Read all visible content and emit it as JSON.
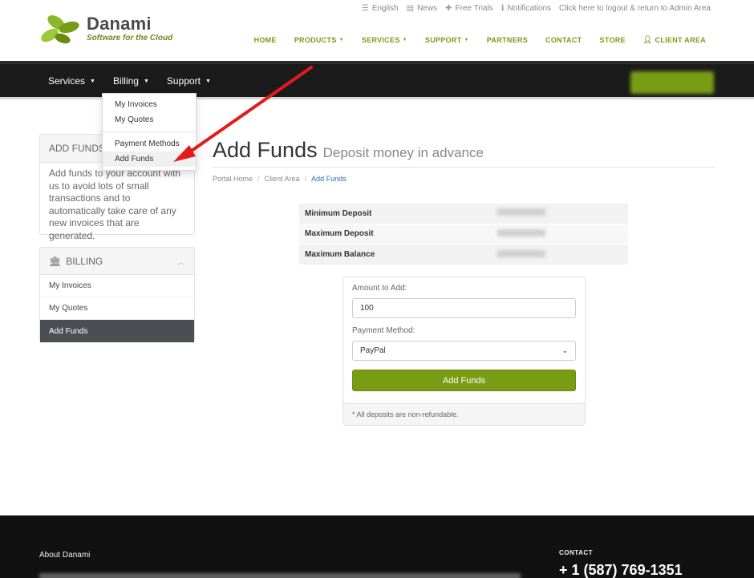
{
  "brand": {
    "name": "Danami",
    "tagline": "Software for the Cloud",
    "accent_color": "#7a9c15"
  },
  "utility_nav": [
    {
      "icon": "language-icon",
      "label": "English"
    },
    {
      "icon": "news-icon",
      "label": "News"
    },
    {
      "icon": "gift-icon",
      "label": "Free Trials"
    },
    {
      "icon": "info-icon",
      "label": "Notifications"
    },
    {
      "icon": "",
      "label": "Click here to logout & return to Admin Area"
    }
  ],
  "main_nav": [
    {
      "label": "HOME"
    },
    {
      "label": "PRODUCTS",
      "caret": true
    },
    {
      "label": "SERVICES",
      "caret": true
    },
    {
      "label": "SUPPORT",
      "caret": true
    },
    {
      "label": "PARTNERS"
    },
    {
      "label": "CONTACT"
    },
    {
      "label": "STORE"
    },
    {
      "label": "CLIENT AREA",
      "icon": "user-icon"
    }
  ],
  "client_nav": {
    "items": [
      {
        "label": "Services"
      },
      {
        "label": "Billing"
      },
      {
        "label": "Support"
      }
    ]
  },
  "billing_dropdown": {
    "items": [
      {
        "label": "My Invoices"
      },
      {
        "label": "My Quotes"
      },
      {
        "label": "Payment Methods"
      },
      {
        "label": "Add Funds"
      }
    ]
  },
  "sidebar": {
    "add_funds_panel": {
      "title": "ADD FUNDS",
      "body": "Add funds to your account with us to avoid lots of small transactions and to automatically take care of any new invoices that are generated."
    },
    "billing_panel": {
      "title": "BILLING",
      "items": [
        {
          "label": "My Invoices"
        },
        {
          "label": "My Quotes"
        },
        {
          "label": "Add Funds"
        }
      ]
    }
  },
  "page": {
    "title": "Add Funds",
    "subtitle": "Deposit money in advance",
    "breadcrumb": [
      {
        "label": "Portal Home"
      },
      {
        "label": "Client Area"
      },
      {
        "label": "Add Funds"
      }
    ]
  },
  "deposit_limits": {
    "rows": [
      {
        "label": "Minimum Deposit"
      },
      {
        "label": "Maximum Deposit"
      },
      {
        "label": "Maximum Balance"
      }
    ]
  },
  "form": {
    "amount_label": "Amount to Add:",
    "amount_value": "100",
    "method_label": "Payment Method:",
    "method_value": "PayPal",
    "submit_label": "Add Funds",
    "note": "* All deposits are non-refundable."
  },
  "footer": {
    "about_title": "About Danami",
    "contact_title": "CONTACT",
    "phone": "+ 1 (587) 769-1351"
  }
}
